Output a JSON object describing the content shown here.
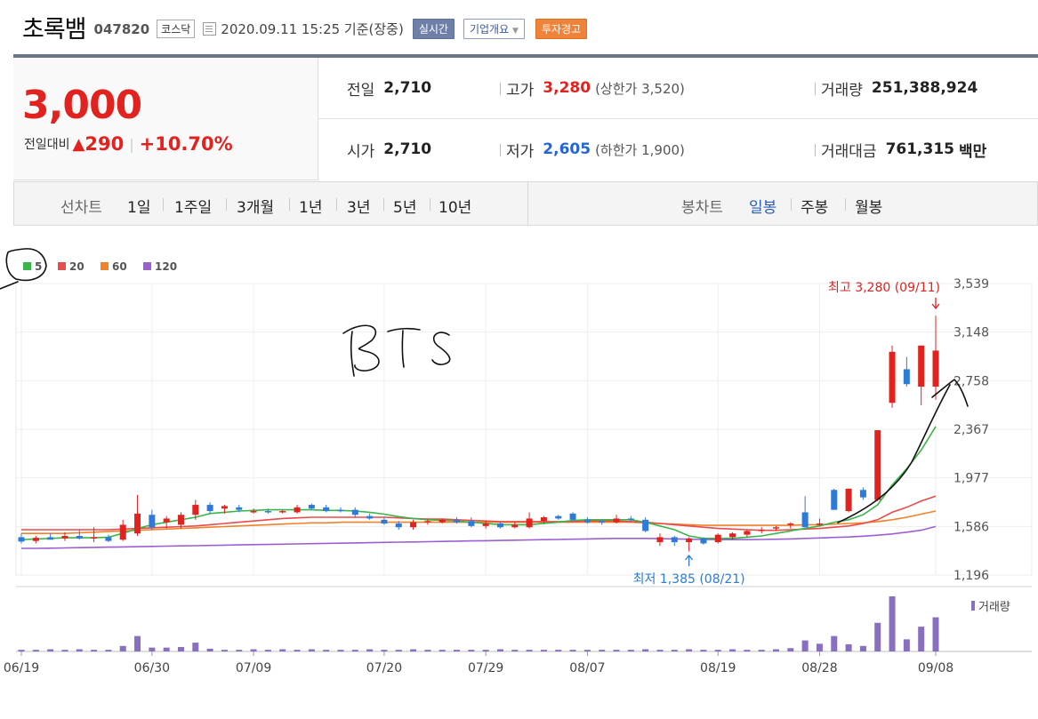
{
  "header": {
    "name": "초록뱀",
    "code": "047820",
    "market": "코스닥",
    "datetime": "2020.09.11 15:25  기준(장중)",
    "btn_live": "실시간",
    "btn_info": "기업개요",
    "btn_warn": "투자경고"
  },
  "summary": {
    "price": "3,000",
    "change_label": "전일대비",
    "change_symbol": "▲",
    "change_amount": "290",
    "change_sep": "|",
    "change_pct": "+10.70%",
    "prev_label": "전일",
    "prev_value": "2,710",
    "open_label": "시가",
    "open_value": "2,710",
    "high_label": "고가",
    "high_value": "3,280",
    "high_sub": "(상한가 3,520)",
    "low_label": "저가",
    "low_value": "2,605",
    "low_sub": "(하한가 1,900)",
    "volume_label": "거래량",
    "volume_value": "251,388,924",
    "amount_label": "거래대금",
    "amount_value": "761,315",
    "amount_unit": "백만"
  },
  "nav": {
    "line_label": "선차트",
    "periods": [
      "1일",
      "1주일",
      "3개월",
      "1년",
      "3년",
      "5년",
      "10년"
    ],
    "candle_label": "봉차트",
    "candle_types": [
      "일봉",
      "주봉",
      "월봉"
    ],
    "active_candle": "일봉"
  },
  "colors": {
    "up": "#e1221f",
    "down": "#2e7ad8",
    "ma5": "#3ab54a",
    "ma20": "#e84b4b",
    "ma60": "#f0822a",
    "ma120": "#9c5fd0",
    "volume": "#8a6fc0"
  },
  "chart_data": {
    "type": "candlestick",
    "legend": [
      "5",
      "20",
      "60",
      "120"
    ],
    "y_ticks": [
      "3,539",
      "3,148",
      "2,758",
      "2,367",
      "1,977",
      "1,586",
      "1,196"
    ],
    "ylim": [
      1196,
      3539
    ],
    "x_labels": [
      "06/19",
      "06/30",
      "07/09",
      "07/20",
      "07/29",
      "08/07",
      "08/19",
      "08/28",
      "09/08"
    ],
    "high_annotation": "최고 3,280 (09/11)",
    "low_annotation": "최저 1,385 (08/21)",
    "volume_legend": "거래량",
    "handwriting": "BTS",
    "ohlc": [
      {
        "o": 1500,
        "h": 1530,
        "l": 1450,
        "c": 1465
      },
      {
        "o": 1470,
        "h": 1510,
        "l": 1450,
        "c": 1495
      },
      {
        "o": 1500,
        "h": 1530,
        "l": 1480,
        "c": 1480
      },
      {
        "o": 1490,
        "h": 1540,
        "l": 1470,
        "c": 1510
      },
      {
        "o": 1510,
        "h": 1560,
        "l": 1480,
        "c": 1490
      },
      {
        "o": 1490,
        "h": 1580,
        "l": 1460,
        "c": 1500
      },
      {
        "o": 1500,
        "h": 1520,
        "l": 1460,
        "c": 1470
      },
      {
        "o": 1480,
        "h": 1640,
        "l": 1470,
        "c": 1600
      },
      {
        "o": 1530,
        "h": 1840,
        "l": 1510,
        "c": 1690
      },
      {
        "o": 1680,
        "h": 1720,
        "l": 1560,
        "c": 1580
      },
      {
        "o": 1620,
        "h": 1670,
        "l": 1570,
        "c": 1650
      },
      {
        "o": 1600,
        "h": 1700,
        "l": 1570,
        "c": 1680
      },
      {
        "o": 1680,
        "h": 1800,
        "l": 1640,
        "c": 1760
      },
      {
        "o": 1760,
        "h": 1780,
        "l": 1690,
        "c": 1710
      },
      {
        "o": 1730,
        "h": 1760,
        "l": 1690,
        "c": 1750
      },
      {
        "o": 1740,
        "h": 1760,
        "l": 1700,
        "c": 1720
      },
      {
        "o": 1700,
        "h": 1730,
        "l": 1690,
        "c": 1710
      },
      {
        "o": 1710,
        "h": 1730,
        "l": 1690,
        "c": 1700
      },
      {
        "o": 1700,
        "h": 1720,
        "l": 1690,
        "c": 1710
      },
      {
        "o": 1700,
        "h": 1760,
        "l": 1690,
        "c": 1740
      },
      {
        "o": 1760,
        "h": 1770,
        "l": 1720,
        "c": 1730
      },
      {
        "o": 1740,
        "h": 1760,
        "l": 1700,
        "c": 1710
      },
      {
        "o": 1720,
        "h": 1740,
        "l": 1700,
        "c": 1710
      },
      {
        "o": 1720,
        "h": 1740,
        "l": 1660,
        "c": 1680
      },
      {
        "o": 1670,
        "h": 1690,
        "l": 1640,
        "c": 1650
      },
      {
        "o": 1640,
        "h": 1660,
        "l": 1600,
        "c": 1610
      },
      {
        "o": 1610,
        "h": 1630,
        "l": 1560,
        "c": 1580
      },
      {
        "o": 1580,
        "h": 1640,
        "l": 1560,
        "c": 1620
      },
      {
        "o": 1620,
        "h": 1650,
        "l": 1600,
        "c": 1630
      },
      {
        "o": 1620,
        "h": 1650,
        "l": 1610,
        "c": 1640
      },
      {
        "o": 1640,
        "h": 1660,
        "l": 1610,
        "c": 1620
      },
      {
        "o": 1630,
        "h": 1660,
        "l": 1580,
        "c": 1590
      },
      {
        "o": 1590,
        "h": 1630,
        "l": 1570,
        "c": 1610
      },
      {
        "o": 1610,
        "h": 1620,
        "l": 1570,
        "c": 1580
      },
      {
        "o": 1580,
        "h": 1620,
        "l": 1570,
        "c": 1600
      },
      {
        "o": 1580,
        "h": 1700,
        "l": 1570,
        "c": 1650
      },
      {
        "o": 1630,
        "h": 1670,
        "l": 1610,
        "c": 1660
      },
      {
        "o": 1670,
        "h": 1680,
        "l": 1640,
        "c": 1650
      },
      {
        "o": 1690,
        "h": 1700,
        "l": 1630,
        "c": 1640
      },
      {
        "o": 1640,
        "h": 1660,
        "l": 1610,
        "c": 1620
      },
      {
        "o": 1630,
        "h": 1640,
        "l": 1600,
        "c": 1620
      },
      {
        "o": 1620,
        "h": 1680,
        "l": 1610,
        "c": 1650
      },
      {
        "o": 1650,
        "h": 1670,
        "l": 1620,
        "c": 1640
      },
      {
        "o": 1640,
        "h": 1660,
        "l": 1540,
        "c": 1550
      },
      {
        "o": 1460,
        "h": 1530,
        "l": 1430,
        "c": 1500
      },
      {
        "o": 1500,
        "h": 1510,
        "l": 1430,
        "c": 1460
      },
      {
        "o": 1460,
        "h": 1500,
        "l": 1385,
        "c": 1490
      },
      {
        "o": 1490,
        "h": 1500,
        "l": 1440,
        "c": 1450
      },
      {
        "o": 1460,
        "h": 1530,
        "l": 1450,
        "c": 1520
      },
      {
        "o": 1500,
        "h": 1540,
        "l": 1480,
        "c": 1530
      },
      {
        "o": 1520,
        "h": 1560,
        "l": 1500,
        "c": 1550
      },
      {
        "o": 1550,
        "h": 1580,
        "l": 1530,
        "c": 1560
      },
      {
        "o": 1570,
        "h": 1590,
        "l": 1550,
        "c": 1580
      },
      {
        "o": 1600,
        "h": 1620,
        "l": 1570,
        "c": 1610
      },
      {
        "o": 1700,
        "h": 1830,
        "l": 1580,
        "c": 1580
      },
      {
        "o": 1600,
        "h": 1650,
        "l": 1590,
        "c": 1610
      },
      {
        "o": 1880,
        "h": 1890,
        "l": 1720,
        "c": 1720
      },
      {
        "o": 1710,
        "h": 1890,
        "l": 1700,
        "c": 1890
      },
      {
        "o": 1880,
        "h": 1900,
        "l": 1800,
        "c": 1820
      },
      {
        "o": 1800,
        "h": 2360,
        "l": 1790,
        "c": 2360
      },
      {
        "o": 2580,
        "h": 3040,
        "l": 2540,
        "c": 2990
      },
      {
        "o": 2850,
        "h": 2950,
        "l": 2710,
        "c": 2730
      },
      {
        "o": 2710,
        "h": 3040,
        "l": 2560,
        "c": 3040
      },
      {
        "o": 2710,
        "h": 3280,
        "l": 2605,
        "c": 3000
      }
    ],
    "volume": [
      3,
      3,
      4,
      3,
      4,
      3,
      3,
      10,
      28,
      7,
      7,
      8,
      16,
      5,
      3,
      3,
      4,
      3,
      4,
      3,
      4,
      3,
      3,
      3,
      4,
      3,
      3,
      4,
      3,
      3,
      3,
      3,
      3,
      4,
      3,
      3,
      3,
      3,
      3,
      3,
      3,
      3,
      3,
      4,
      3,
      3,
      4,
      3,
      3,
      4,
      3,
      3,
      4,
      6,
      20,
      14,
      28,
      13,
      10,
      52,
      100,
      22,
      45,
      62
    ],
    "ma5": [
      1480,
      1485,
      1490,
      1495,
      1495,
      1495,
      1500,
      1530,
      1570,
      1600,
      1620,
      1640,
      1660,
      1690,
      1700,
      1710,
      1715,
      1720,
      1720,
      1720,
      1720,
      1715,
      1715,
      1710,
      1700,
      1685,
      1665,
      1650,
      1640,
      1635,
      1630,
      1620,
      1610,
      1600,
      1600,
      1600,
      1610,
      1620,
      1635,
      1640,
      1640,
      1640,
      1640,
      1620,
      1590,
      1560,
      1510,
      1490,
      1490,
      1490,
      1500,
      1510,
      1530,
      1550,
      1570,
      1590,
      1620,
      1640,
      1680,
      1760,
      1920,
      2050,
      2200,
      2390
    ],
    "ma20": [
      1560,
      1560,
      1560,
      1560,
      1560,
      1560,
      1560,
      1565,
      1570,
      1575,
      1580,
      1585,
      1590,
      1600,
      1610,
      1620,
      1630,
      1640,
      1650,
      1655,
      1660,
      1660,
      1660,
      1660,
      1660,
      1660,
      1655,
      1650,
      1645,
      1645,
      1640,
      1635,
      1630,
      1625,
      1625,
      1625,
      1625,
      1625,
      1625,
      1630,
      1630,
      1630,
      1625,
      1620,
      1610,
      1600,
      1590,
      1580,
      1570,
      1565,
      1560,
      1555,
      1555,
      1560,
      1565,
      1570,
      1580,
      1590,
      1610,
      1640,
      1700,
      1740,
      1790,
      1830
    ],
    "ma60": [
      1530,
      1530,
      1530,
      1530,
      1535,
      1540,
      1545,
      1550,
      1555,
      1560,
      1565,
      1570,
      1575,
      1580,
      1585,
      1590,
      1595,
      1600,
      1605,
      1610,
      1615,
      1615,
      1620,
      1620,
      1620,
      1620,
      1620,
      1620,
      1620,
      1620,
      1620,
      1620,
      1620,
      1620,
      1620,
      1620,
      1620,
      1620,
      1620,
      1620,
      1620,
      1620,
      1620,
      1615,
      1610,
      1605,
      1600,
      1595,
      1595,
      1595,
      1595,
      1595,
      1595,
      1595,
      1600,
      1600,
      1605,
      1610,
      1615,
      1625,
      1640,
      1660,
      1685,
      1710
    ],
    "ma120": [
      1410,
      1410,
      1412,
      1414,
      1416,
      1418,
      1420,
      1422,
      1424,
      1426,
      1428,
      1430,
      1432,
      1434,
      1436,
      1438,
      1440,
      1442,
      1444,
      1446,
      1448,
      1450,
      1452,
      1454,
      1456,
      1458,
      1460,
      1462,
      1464,
      1466,
      1468,
      1470,
      1472,
      1474,
      1476,
      1478,
      1480,
      1482,
      1484,
      1486,
      1488,
      1490,
      1490,
      1490,
      1488,
      1486,
      1484,
      1482,
      1480,
      1480,
      1480,
      1482,
      1484,
      1486,
      1490,
      1494,
      1498,
      1502,
      1508,
      1516,
      1526,
      1540,
      1556,
      1586
    ]
  }
}
